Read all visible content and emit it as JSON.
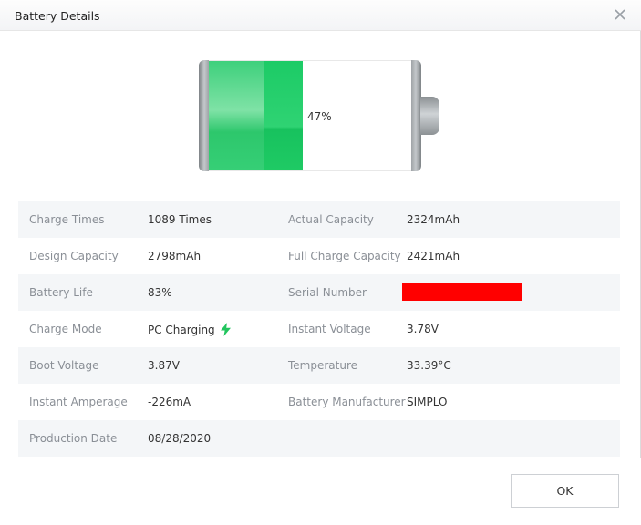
{
  "dialog": {
    "title": "Battery Details",
    "close_icon": "close-icon"
  },
  "battery": {
    "percent_text": "47%",
    "level": 0.47,
    "fill_color": "#22cc68"
  },
  "details": {
    "rows": [
      {
        "left_label": "Charge Times",
        "left_value": "1089 Times",
        "right_label": "Actual Capacity",
        "right_value": "2324mAh"
      },
      {
        "left_label": "Design Capacity",
        "left_value": "2798mAh",
        "right_label": "Full Charge Capacity",
        "right_value": "2421mAh"
      },
      {
        "left_label": "Battery Life",
        "left_value": "83%",
        "right_label": "Serial Number",
        "right_value": ""
      },
      {
        "left_label": "Charge Mode",
        "left_value": "PC Charging",
        "right_label": "Instant Voltage",
        "right_value": "3.78V"
      },
      {
        "left_label": "Boot Voltage",
        "left_value": "3.87V",
        "right_label": "Temperature",
        "right_value": "33.39°C"
      },
      {
        "left_label": "Instant Amperage",
        "left_value": "-226mA",
        "right_label": "Battery Manufacturer",
        "right_value": "SIMPLO"
      },
      {
        "left_label": "Production Date",
        "left_value": "08/28/2020",
        "right_label": "",
        "right_value": ""
      }
    ],
    "serial_redaction_color": "#ff0000",
    "charge_icon": "lightning-bolt-icon",
    "charge_icon_color": "#22c55e"
  },
  "footer": {
    "ok_label": "OK"
  }
}
